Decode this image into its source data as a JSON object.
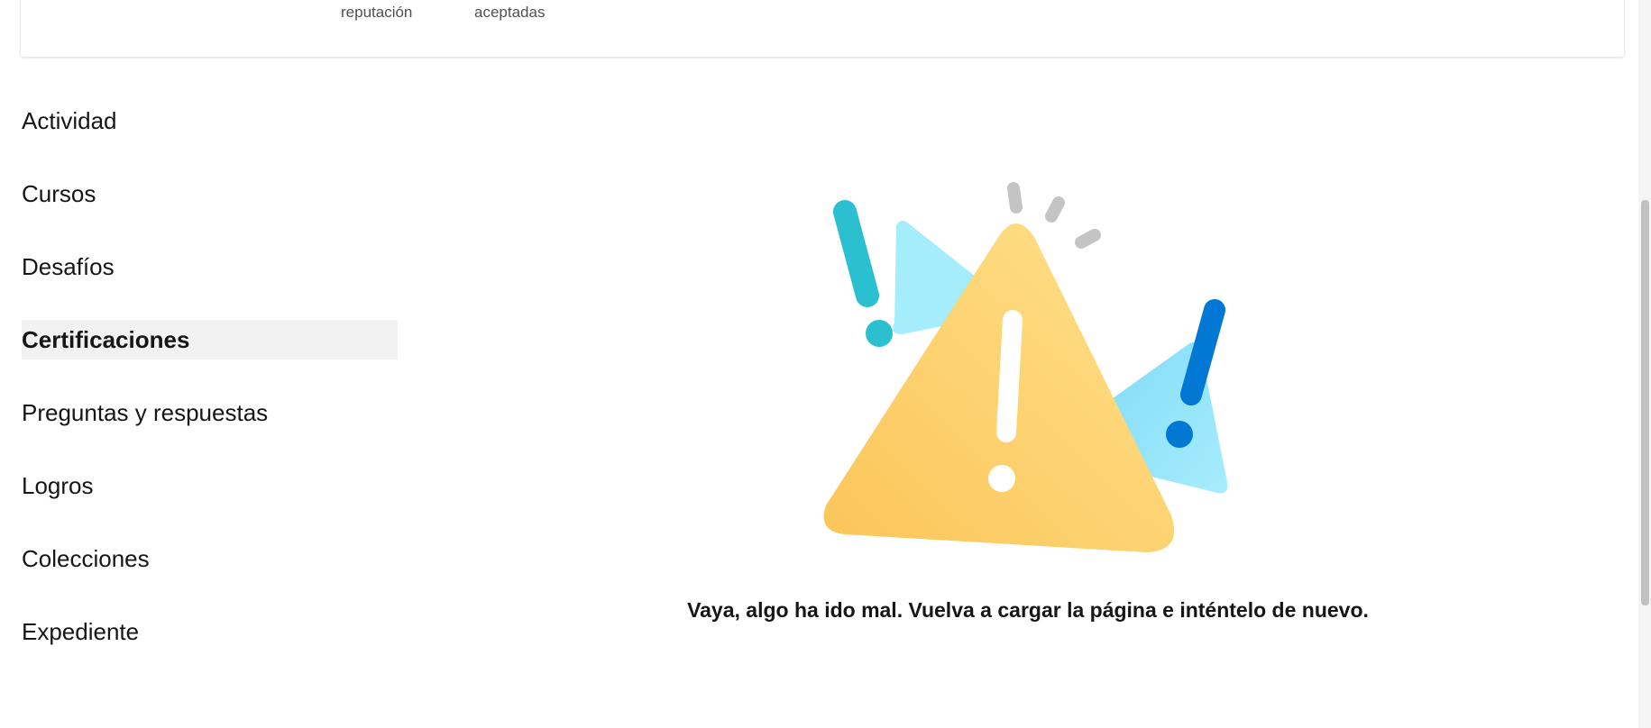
{
  "stats_card": {
    "labels": [
      {
        "text": "reputación"
      },
      {
        "text": "aceptadas"
      }
    ]
  },
  "nav": {
    "items": [
      {
        "label": "Actividad",
        "active": false
      },
      {
        "label": "Cursos",
        "active": false
      },
      {
        "label": "Desafíos",
        "active": false
      },
      {
        "label": "Certificaciones",
        "active": true
      },
      {
        "label": "Preguntas y respuestas",
        "active": false
      },
      {
        "label": "Logros",
        "active": false
      },
      {
        "label": "Colecciones",
        "active": false
      },
      {
        "label": "Expediente",
        "active": false
      }
    ]
  },
  "error": {
    "message": "Vaya, algo ha ido mal. Vuelva a cargar la página e inténtelo de nuevo.",
    "icon": "warning-triangle-icon"
  },
  "colors": {
    "warning_yellow": "#fdd46a",
    "light_blue": "#9eeafd",
    "teal": "#2bc0d0",
    "blue": "#0078d4",
    "gray_marks": "#c4c4c4",
    "active_bg": "#f2f2f2"
  }
}
